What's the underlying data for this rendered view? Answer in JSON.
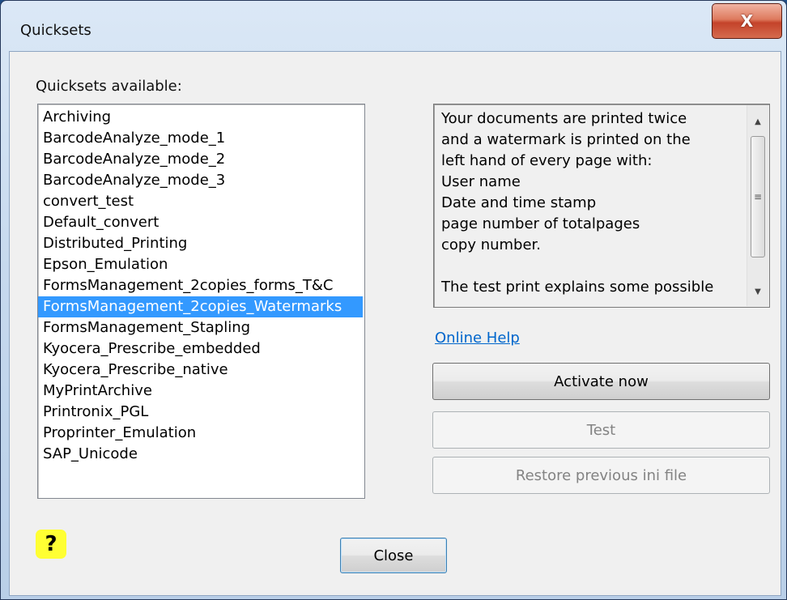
{
  "window": {
    "title": "Quicksets",
    "close_glyph": "X"
  },
  "quicksets": {
    "label": "Quicksets available:",
    "selected_index": 9,
    "items": [
      "Archiving",
      "BarcodeAnalyze_mode_1",
      "BarcodeAnalyze_mode_2",
      "BarcodeAnalyze_mode_3",
      "convert_test",
      "Default_convert",
      "Distributed_Printing",
      "Epson_Emulation",
      "FormsManagement_2copies_forms_T&C",
      "FormsManagement_2copies_Watermarks",
      "FormsManagement_Stapling",
      "Kyocera_Prescribe_embedded",
      "Kyocera_Prescribe_native",
      "MyPrintArchive",
      "Printronix_PGL",
      "Proprinter_Emulation",
      "SAP_Unicode"
    ]
  },
  "description": {
    "text": "Your documents are printed twice\nand a watermark is printed on the\nleft hand of every page with:\nUser name\nDate and time stamp\npage number of totalpages\ncopy number.\n\nThe test print explains some possible"
  },
  "links": {
    "online_help": "Online Help"
  },
  "buttons": {
    "activate": "Activate now",
    "test": "Test",
    "restore": "Restore previous ini file",
    "close": "Close"
  },
  "help": {
    "glyph": "?"
  },
  "colors": {
    "selection": "#3399ff",
    "help_icon_bg": "#ffff33",
    "link": "#0066cc"
  }
}
